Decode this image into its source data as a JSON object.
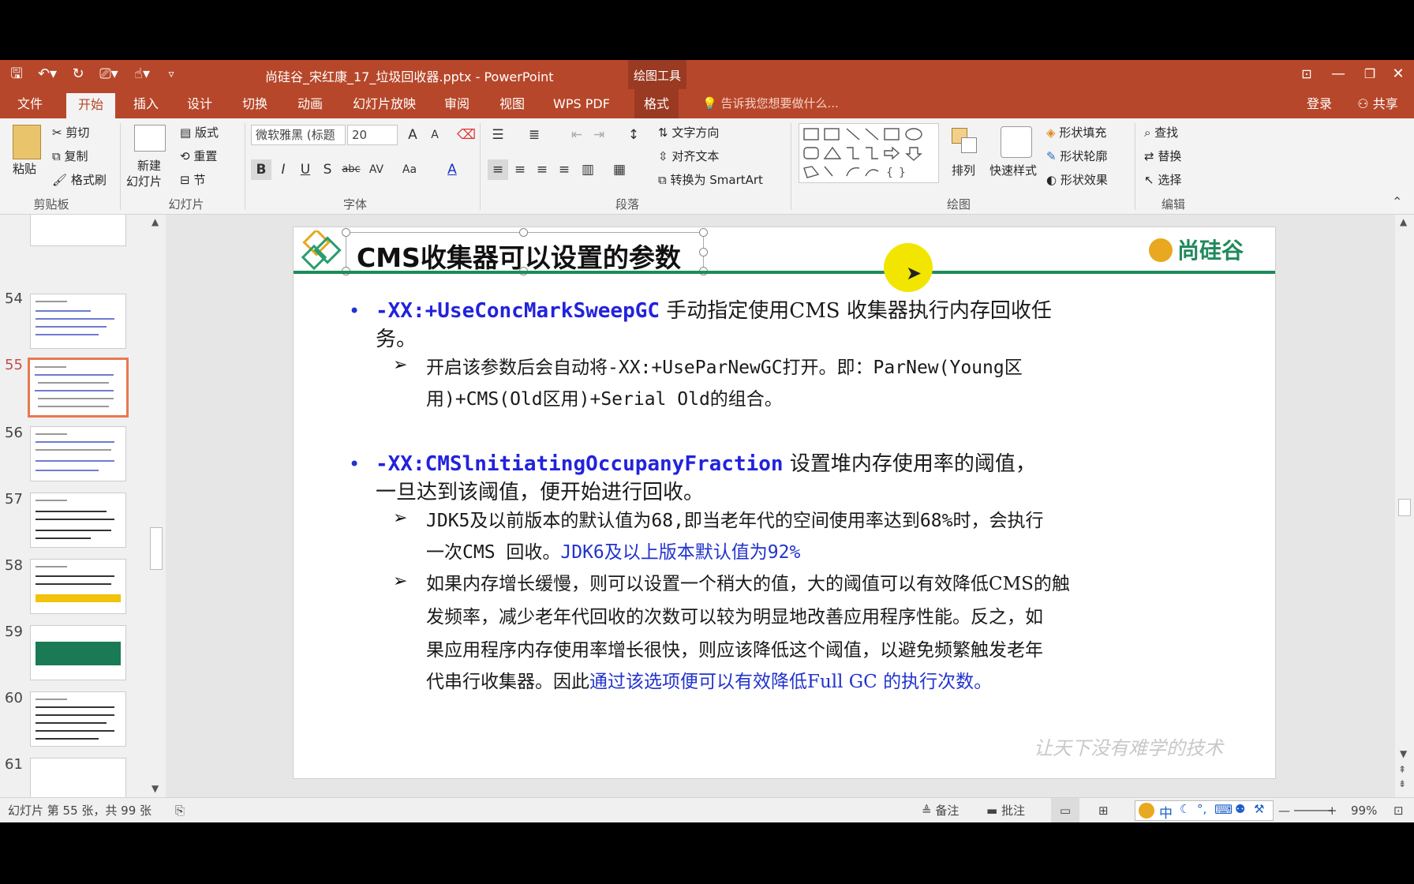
{
  "window": {
    "title": "尚硅谷_宋红康_17_垃圾回收器.pptx - PowerPoint",
    "context_group": "绘图工具"
  },
  "tabs": [
    "文件",
    "开始",
    "插入",
    "设计",
    "切换",
    "动画",
    "幻灯片放映",
    "审阅",
    "视图",
    "WPS PDF",
    "格式"
  ],
  "active_tab": "开始",
  "tell_me": "告诉我您想要做什么...",
  "account": {
    "login": "登录",
    "share": "共享"
  },
  "ribbon": {
    "clipboard": {
      "paste": "粘贴",
      "cut": "剪切",
      "copy": "复制",
      "format_painter": "格式刷",
      "group": "剪贴板"
    },
    "slides": {
      "new_slide_1": "新建",
      "new_slide_2": "幻灯片",
      "layout": "版式",
      "reset": "重置",
      "section": "节",
      "group": "幻灯片"
    },
    "font": {
      "font_name": "微软雅黑 (标题",
      "font_size": "20",
      "group": "字体"
    },
    "paragraph": {
      "text_direction": "文字方向",
      "align_text": "对齐文本",
      "smartart": "转换为 SmartArt",
      "group": "段落"
    },
    "drawing": {
      "arrange": "排列",
      "quick_styles": "快速样式",
      "shape_fill": "形状填充",
      "shape_outline": "形状轮廓",
      "shape_effects": "形状效果",
      "group": "绘图"
    },
    "editing": {
      "find": "查找",
      "replace": "替换",
      "select": "选择",
      "group": "编辑"
    }
  },
  "thumbnails": [
    "54",
    "55",
    "56",
    "57",
    "58",
    "59",
    "60",
    "61"
  ],
  "selected_thumbnail": "55",
  "slide": {
    "title": "CMS收集器可以设置的参数",
    "logo": "尚硅谷",
    "watermark": "让天下没有难学的技术",
    "p1_kw": "-XX:+UseConcMarkSweepGC",
    "p1_text_a": " 手动指定使用CMS 收集器执行内存回收任",
    "p1_text_b": "务。",
    "p1_sub_a": "开启该参数后会自动将-XX:+UseParNewGC打开。即：ParNew(Young区",
    "p1_sub_b": "用)+CMS(Old区用)+Serial Old的组合。",
    "p2_kw": "-XX:CMSlnitiatingOccupanyFraction",
    "p2_text_a": " 设置堆内存使用率的阈值，",
    "p2_text_b": "一旦达到该阈值，便开始进行回收。",
    "p2_sub1_a": "JDK5及以前版本的默认值为68,即当老年代的空间使用率达到68%时，会执行",
    "p2_sub1_b_plain": "一次CMS 回收。",
    "p2_sub1_b_blue": "JDK6及以上版本默认值为92%",
    "p2_sub2_a": "如果内存增长缓慢，则可以设置一个稍大的值，大的阈值可以有效降低CMS的触",
    "p2_sub2_b": "发频率，减少老年代回收的次数可以较为明显地改善应用程序性能。反之，如",
    "p2_sub2_c": "果应用程序内存使用率增长很快，则应该降低这个阈值，以避免频繁触发老年",
    "p2_sub2_d_plain": "代串行收集器。因此",
    "p2_sub2_d_blue": "通过该选项便可以有效降低Full GC 的执行次数。"
  },
  "status": {
    "slide_info": "幻灯片 第 55 张，共 99 张",
    "notes": "备注",
    "comments": "批注",
    "ime": "中",
    "zoom": "99%"
  },
  "colors": {
    "accent": "#b7472a",
    "header_line": "#1f8a5a",
    "keyword_blue": "#2222dd"
  }
}
